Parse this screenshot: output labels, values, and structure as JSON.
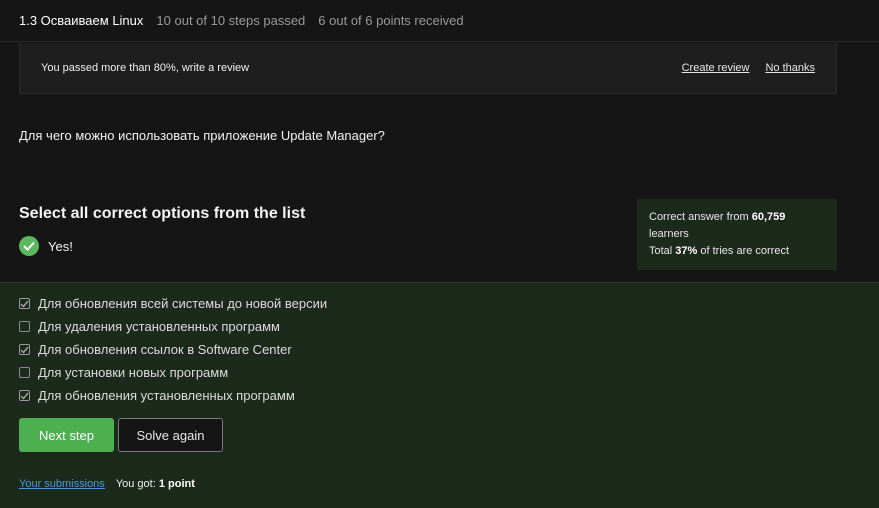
{
  "header": {
    "lesson_title": "1.3 Осваиваем Linux",
    "steps_text": "10 out of 10 steps passed",
    "points_text": "6 out of 6 points  received"
  },
  "review_banner": {
    "message": "You passed more than 80%, write a review",
    "create_label": "Create review",
    "dismiss_label": "No thanks"
  },
  "question": "Для чего можно использовать приложение Update Manager?",
  "instruction": "Select all correct options from the list",
  "result_text": "Yes!",
  "stats": {
    "line1_prefix": "Correct answer from ",
    "learners_count": "60,759",
    "line1_suffix": "learners",
    "line2_prefix": "Total ",
    "percent": "37%",
    "line2_suffix": " of tries are correct"
  },
  "options": [
    {
      "label": "Для обновления всей системы до новой версии",
      "checked": true
    },
    {
      "label": "Для удаления установленных программ",
      "checked": false
    },
    {
      "label": "Для обновления ссылок в Software Center",
      "checked": true
    },
    {
      "label": "Для установки новых программ",
      "checked": false
    },
    {
      "label": "Для обновления установленных программ",
      "checked": true
    }
  ],
  "buttons": {
    "next_label": "Next step",
    "again_label": "Solve again"
  },
  "footer": {
    "submissions_label": "Your submissions",
    "got_prefix": "You got: ",
    "got_value": "1 point"
  },
  "colors": {
    "accent_green": "#4caf50",
    "success_check": "#5bb85d",
    "answer_panel_bg": "#1c2a1c",
    "page_bg": "#151515",
    "link_blue": "#4a9ae0"
  }
}
